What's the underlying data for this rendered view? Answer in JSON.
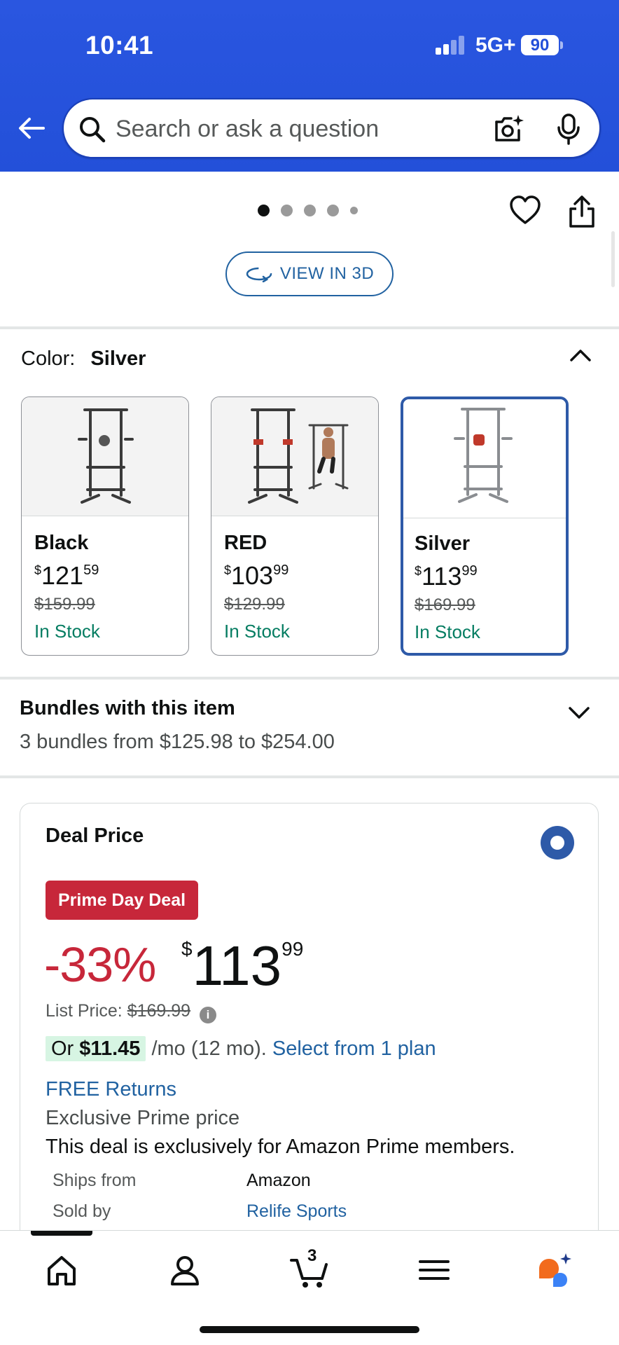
{
  "status_bar": {
    "time": "10:41",
    "network": "5G+",
    "battery": "90"
  },
  "search": {
    "placeholder": "Search or ask a question"
  },
  "carousel": {
    "dots": 5,
    "active_index": 0,
    "view_3d_label": "VIEW IN 3D"
  },
  "color_selector": {
    "label": "Color:",
    "selected": "Silver",
    "options": [
      {
        "name": "Black",
        "currency": "$",
        "whole": "121",
        "cents": "59",
        "list_price": "$159.99",
        "stock": "In Stock",
        "accent": "#3a3a3a"
      },
      {
        "name": "RED",
        "currency": "$",
        "whole": "103",
        "cents": "99",
        "list_price": "$129.99",
        "stock": "In Stock",
        "accent": "#c0392b"
      },
      {
        "name": "Silver",
        "currency": "$",
        "whole": "113",
        "cents": "99",
        "list_price": "$169.99",
        "stock": "In Stock",
        "accent": "#c0392b"
      }
    ]
  },
  "bundles": {
    "title": "Bundles with this item",
    "subtitle": "3 bundles from $125.98 to $254.00"
  },
  "deal": {
    "title": "Deal Price",
    "badge": "Prime Day Deal",
    "discount": "-33%",
    "currency": "$",
    "whole": "113",
    "cents": "99",
    "list_price_label": "List Price:",
    "list_price": "$169.99",
    "monthly_prefix": "Or",
    "monthly_amount": "$11.45",
    "monthly_suffix": "/mo (12 mo).",
    "plan_link": "Select from 1 plan",
    "free_returns": "FREE Returns",
    "exclusive": "Exclusive Prime price",
    "exclusive_sub": "This deal is exclusively for Amazon Prime members.",
    "ships_from_label": "Ships from",
    "ships_from": "Amazon",
    "sold_by_label": "Sold by",
    "sold_by": "Relife Sports"
  },
  "bottom_nav": {
    "cart_count": "3",
    "items": [
      "home-icon",
      "account-icon",
      "cart-icon",
      "menu-icon",
      "assistant-icon"
    ]
  },
  "colors": {
    "header": "#2350d9",
    "link": "#2162a1",
    "deal_red": "#c7273a",
    "in_stock": "#067d62",
    "selected_border": "#2e5aa8"
  }
}
